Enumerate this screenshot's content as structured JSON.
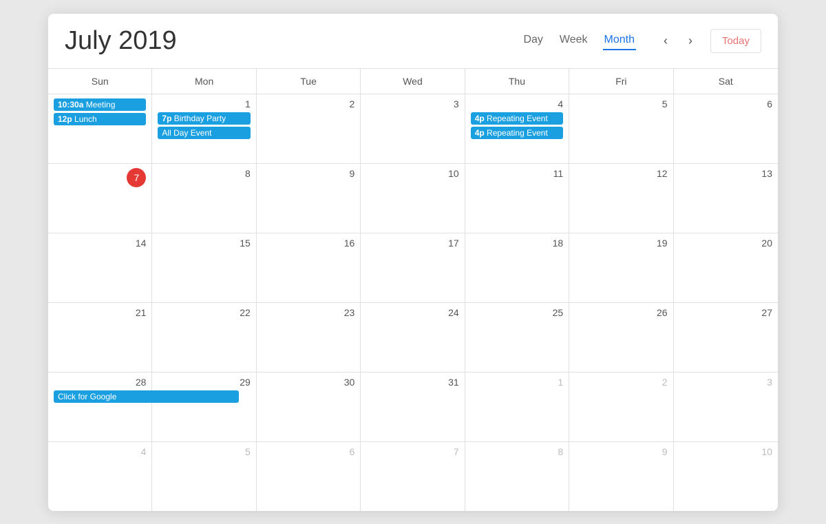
{
  "header": {
    "title": "July 2019",
    "views": [
      {
        "label": "Day",
        "active": false,
        "key": "day"
      },
      {
        "label": "Week",
        "active": false,
        "key": "week"
      },
      {
        "label": "Month",
        "active": true,
        "key": "month"
      }
    ],
    "nav_prev": "‹",
    "nav_next": "›",
    "today_label": "Today"
  },
  "day_headers": [
    "Sun",
    "Mon",
    "Tue",
    "Wed",
    "Thu",
    "Fri",
    "Sat"
  ],
  "weeks": [
    {
      "days": [
        {
          "date": "",
          "display": "",
          "other_month": false,
          "is_today": false,
          "events": [
            {
              "time": "10:30a",
              "title": "Meeting",
              "color": "#1a9fe0"
            },
            {
              "time": "12p",
              "title": "Lunch",
              "color": "#1a9fe0"
            }
          ]
        },
        {
          "date": "1",
          "display": "1",
          "other_month": false,
          "is_today": false,
          "events": [
            {
              "time": "7p",
              "title": "Birthday Party",
              "color": "#1a9fe0"
            },
            {
              "time": "",
              "title": "All Day Event",
              "color": "#1a9fe0"
            }
          ]
        },
        {
          "date": "2",
          "display": "2",
          "other_month": false,
          "is_today": false,
          "events": []
        },
        {
          "date": "3",
          "display": "3",
          "other_month": false,
          "is_today": false,
          "events": []
        },
        {
          "date": "4",
          "display": "4",
          "other_month": false,
          "is_today": false,
          "events": [
            {
              "time": "4p",
              "title": "Repeating Event",
              "color": "#1a9fe0"
            },
            {
              "time": "4p",
              "title": "Repeating Event",
              "color": "#1a9fe0"
            }
          ]
        },
        {
          "date": "5",
          "display": "5",
          "other_month": false,
          "is_today": false,
          "events": []
        },
        {
          "date": "6",
          "display": "6",
          "other_month": false,
          "is_today": false,
          "events": []
        }
      ]
    },
    {
      "days": [
        {
          "date": "7",
          "display": "7",
          "other_month": false,
          "is_today": true,
          "events": []
        },
        {
          "date": "8",
          "display": "8",
          "other_month": false,
          "is_today": false,
          "events": []
        },
        {
          "date": "9",
          "display": "9",
          "other_month": false,
          "is_today": false,
          "events": []
        },
        {
          "date": "10",
          "display": "10",
          "other_month": false,
          "is_today": false,
          "events": []
        },
        {
          "date": "11",
          "display": "11",
          "other_month": false,
          "is_today": false,
          "events": []
        },
        {
          "date": "12",
          "display": "12",
          "other_month": false,
          "is_today": false,
          "events": []
        },
        {
          "date": "13",
          "display": "13",
          "other_month": false,
          "is_today": false,
          "events": []
        }
      ]
    },
    {
      "days": [
        {
          "date": "14",
          "display": "14",
          "other_month": false,
          "is_today": false,
          "events": []
        },
        {
          "date": "15",
          "display": "15",
          "other_month": false,
          "is_today": false,
          "events": []
        },
        {
          "date": "16",
          "display": "16",
          "other_month": false,
          "is_today": false,
          "events": []
        },
        {
          "date": "17",
          "display": "17",
          "other_month": false,
          "is_today": false,
          "events": []
        },
        {
          "date": "18",
          "display": "18",
          "other_month": false,
          "is_today": false,
          "events": []
        },
        {
          "date": "19",
          "display": "19",
          "other_month": false,
          "is_today": false,
          "events": []
        },
        {
          "date": "20",
          "display": "20",
          "other_month": false,
          "is_today": false,
          "events": []
        }
      ]
    },
    {
      "days": [
        {
          "date": "21",
          "display": "21",
          "other_month": false,
          "is_today": false,
          "events": []
        },
        {
          "date": "22",
          "display": "22",
          "other_month": false,
          "is_today": false,
          "events": []
        },
        {
          "date": "23",
          "display": "23",
          "other_month": false,
          "is_today": false,
          "events": []
        },
        {
          "date": "24",
          "display": "24",
          "other_month": false,
          "is_today": false,
          "events": []
        },
        {
          "date": "25",
          "display": "25",
          "other_month": false,
          "is_today": false,
          "events": []
        },
        {
          "date": "26",
          "display": "26",
          "other_month": false,
          "is_today": false,
          "events": []
        },
        {
          "date": "27",
          "display": "27",
          "other_month": false,
          "is_today": false,
          "events": []
        }
      ]
    },
    {
      "days": [
        {
          "date": "28",
          "display": "28",
          "other_month": false,
          "is_today": false,
          "events": [
            {
              "time": "",
              "title": "Click for Google",
              "color": "#1a9fe0",
              "wide": true
            }
          ]
        },
        {
          "date": "29",
          "display": "29",
          "other_month": false,
          "is_today": false,
          "events": []
        },
        {
          "date": "30",
          "display": "30",
          "other_month": false,
          "is_today": false,
          "events": []
        },
        {
          "date": "31",
          "display": "31",
          "other_month": false,
          "is_today": false,
          "events": []
        },
        {
          "date": "1",
          "display": "1",
          "other_month": true,
          "is_today": false,
          "events": []
        },
        {
          "date": "2",
          "display": "2",
          "other_month": true,
          "is_today": false,
          "events": []
        },
        {
          "date": "3",
          "display": "3",
          "other_month": true,
          "is_today": false,
          "events": []
        }
      ]
    },
    {
      "days": [
        {
          "date": "4",
          "display": "4",
          "other_month": true,
          "is_today": false,
          "events": []
        },
        {
          "date": "5",
          "display": "5",
          "other_month": true,
          "is_today": false,
          "events": []
        },
        {
          "date": "6",
          "display": "6",
          "other_month": true,
          "is_today": false,
          "events": []
        },
        {
          "date": "7",
          "display": "7",
          "other_month": true,
          "is_today": false,
          "events": []
        },
        {
          "date": "8",
          "display": "8",
          "other_month": true,
          "is_today": false,
          "events": []
        },
        {
          "date": "9",
          "display": "9",
          "other_month": true,
          "is_today": false,
          "events": []
        },
        {
          "date": "10",
          "display": "10",
          "other_month": true,
          "is_today": false,
          "events": []
        }
      ]
    }
  ]
}
